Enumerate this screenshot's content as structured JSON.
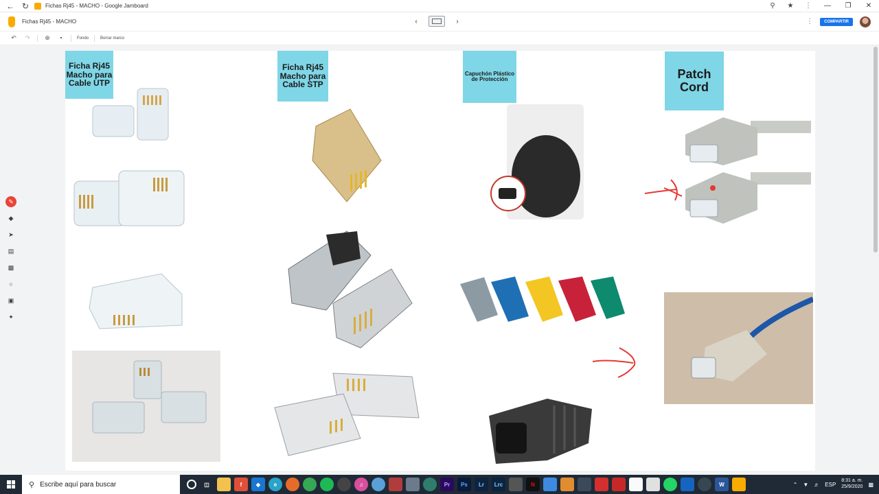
{
  "browser": {
    "tab_title": "Fichas Rj45 - MACHO - Google Jamboard"
  },
  "app": {
    "doc_title": "Fichas Rj45 - MACHO",
    "share_label": "COMPARTIR"
  },
  "toolbar": {
    "background_label": "Fondo",
    "clear_frame_label": "Borrar marco"
  },
  "board": {
    "notes": [
      {
        "text": "Ficha Rj45 Macho para Cable UTP"
      },
      {
        "text": "Ficha Rj45 Macho para Cable STP"
      },
      {
        "text": "Capuchón Plástico de Protección"
      },
      {
        "text": "Patch Cord"
      }
    ],
    "colors": {
      "sticky": "#7fd6e6",
      "ink": "#e53935"
    }
  },
  "taskbar": {
    "search_placeholder": "Escribe aquí para buscar",
    "language": "ESP",
    "time": "8:31 a. m.",
    "date": "25/9/2020"
  }
}
